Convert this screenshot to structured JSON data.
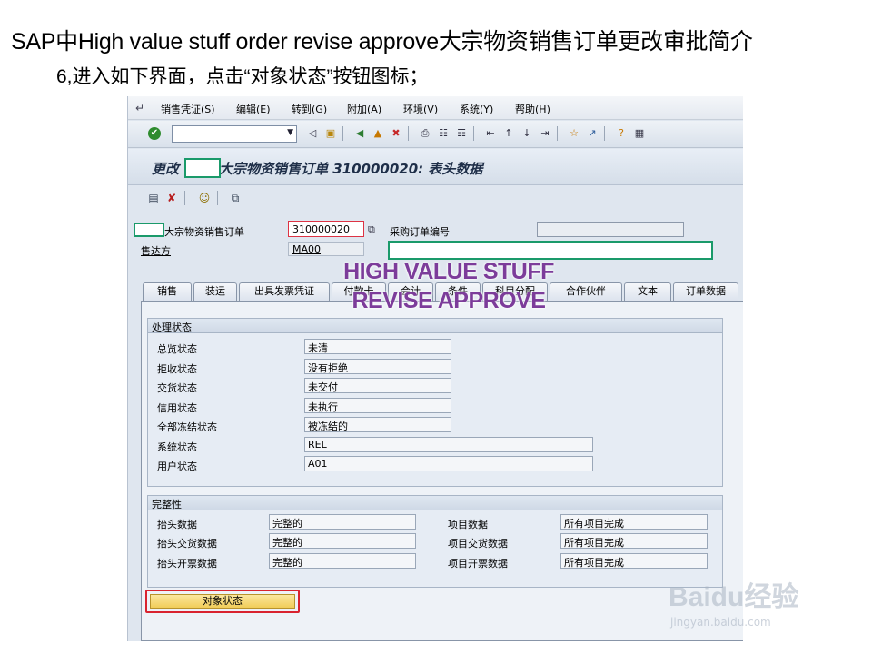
{
  "slide": {
    "title": "SAP中High value stuff order revise approve大宗物资销售订单更改审批简介",
    "step": "6,进入如下界面，点击“对象状态”按钮图标；"
  },
  "menubar": {
    "items": [
      "销售凭证(S)",
      "编辑(E)",
      "转到(G)",
      "附加(A)",
      "环境(V)",
      "系统(Y)",
      "帮助(H)"
    ]
  },
  "screen": {
    "title_prefix": "更改",
    "title_suffix": "大宗物资销售订单 310000020: 表头数据"
  },
  "header": {
    "order_label": "大宗物资销售订单",
    "order_value": "310000020",
    "po_label": "采购订单编号",
    "po_value": "",
    "soldto_label": "售达方",
    "soldto_value": "MA00"
  },
  "tabs": [
    "销售",
    "装运",
    "出具发票凭证",
    "付款卡",
    "会计",
    "条件",
    "科目分配",
    "合作伙伴",
    "文本",
    "订单数据"
  ],
  "processing_status": {
    "title": "处理状态",
    "rows": [
      {
        "label": "总览状态",
        "value": "未清"
      },
      {
        "label": "拒收状态",
        "value": "没有拒绝"
      },
      {
        "label": "交货状态",
        "value": "未交付"
      },
      {
        "label": "信用状态",
        "value": "未执行"
      },
      {
        "label": "全部冻结状态",
        "value": "被冻结的"
      },
      {
        "label": "系统状态",
        "value": "REL"
      },
      {
        "label": "用户状态",
        "value": "A01"
      }
    ]
  },
  "completeness": {
    "title": "完整性",
    "left": [
      {
        "label": "抬头数据",
        "value": "完整的"
      },
      {
        "label": "抬头交货数据",
        "value": "完整的"
      },
      {
        "label": "抬头开票数据",
        "value": "完整的"
      }
    ],
    "right": [
      {
        "label": "项目数据",
        "value": "所有项目完成"
      },
      {
        "label": "项目交货数据",
        "value": "所有项目完成"
      },
      {
        "label": "项目开票数据",
        "value": "所有项目完成"
      }
    ]
  },
  "overlay": {
    "line1": "HIGH VALUE STUFF",
    "line2": "REVISE APPROVE"
  },
  "buttons": {
    "object_status": "对象状态"
  },
  "watermark": {
    "main": "Baidu经验",
    "sub": "jingyan.baidu.com"
  },
  "colors": {
    "highlight_green": "#1a9a6a",
    "highlight_red": "#d9232f",
    "overlay_purple": "#7c3c9a"
  }
}
